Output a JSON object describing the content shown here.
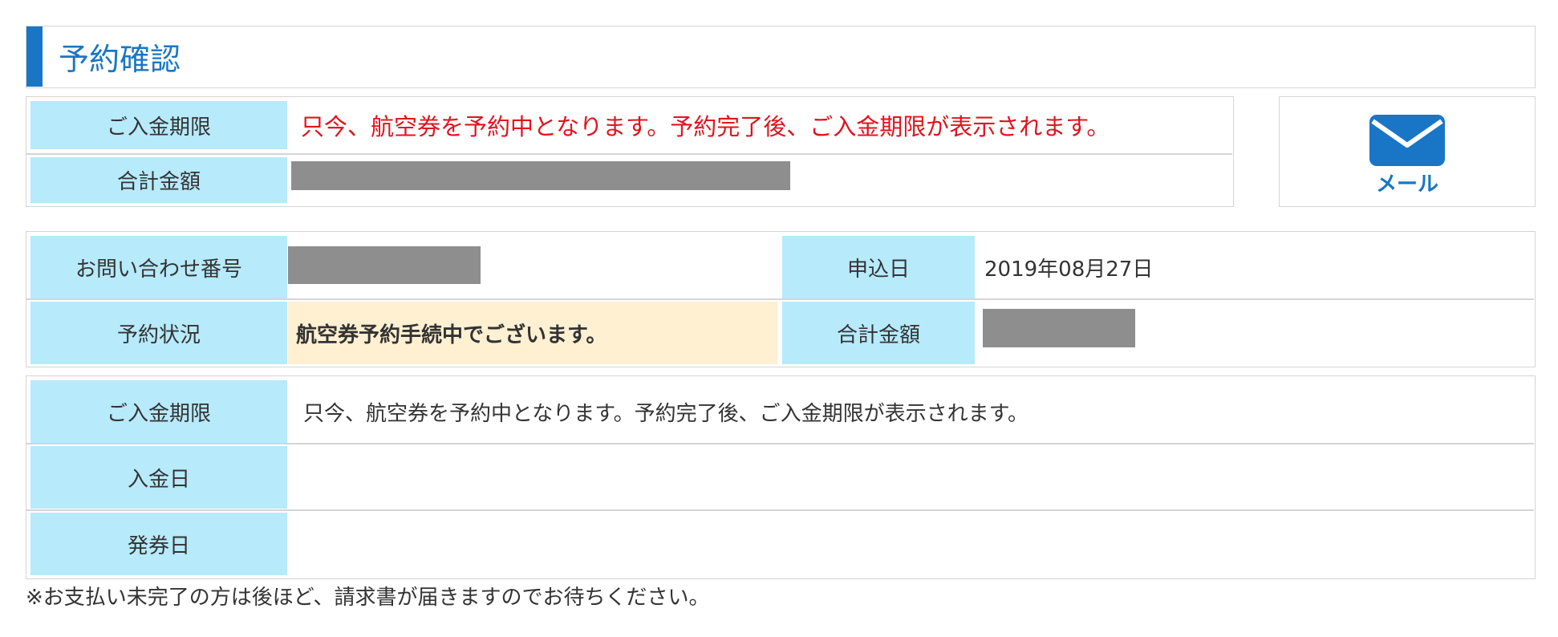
{
  "header": {
    "title": "予約確認"
  },
  "summary": {
    "payment_deadline_label": "ご入金期限",
    "payment_deadline_value": "只今、航空券を予約中となります。予約完了後、ご入金期限が表示されます。",
    "total_label": "合計金額"
  },
  "mail_button": {
    "icon": "envelope-icon",
    "label": "メール"
  },
  "details": {
    "inquiry_label": "お問い合わせ番号",
    "apply_date_label": "申込日",
    "apply_date_value": "2019年08月27日",
    "status_label": "予約状況",
    "status_value": "航空券予約手続中でございます。",
    "total_label": "合計金額"
  },
  "payment": {
    "deadline_label": "ご入金期限",
    "deadline_value": "只今、航空券を予約中となります。予約完了後、ご入金期限が表示されます。",
    "paid_date_label": "入金日",
    "paid_date_value": "",
    "issue_date_label": "発券日",
    "issue_date_value": ""
  },
  "footnote": "※お支払い未完了の方は後ほど、請求書が届きますのでお待ちください。",
  "colors": {
    "accent": "#1976c6",
    "label_bg": "#b7eafb",
    "alert_red": "#e0141e",
    "status_bg": "#fff0d2",
    "redacted": "#8e8e8e"
  }
}
